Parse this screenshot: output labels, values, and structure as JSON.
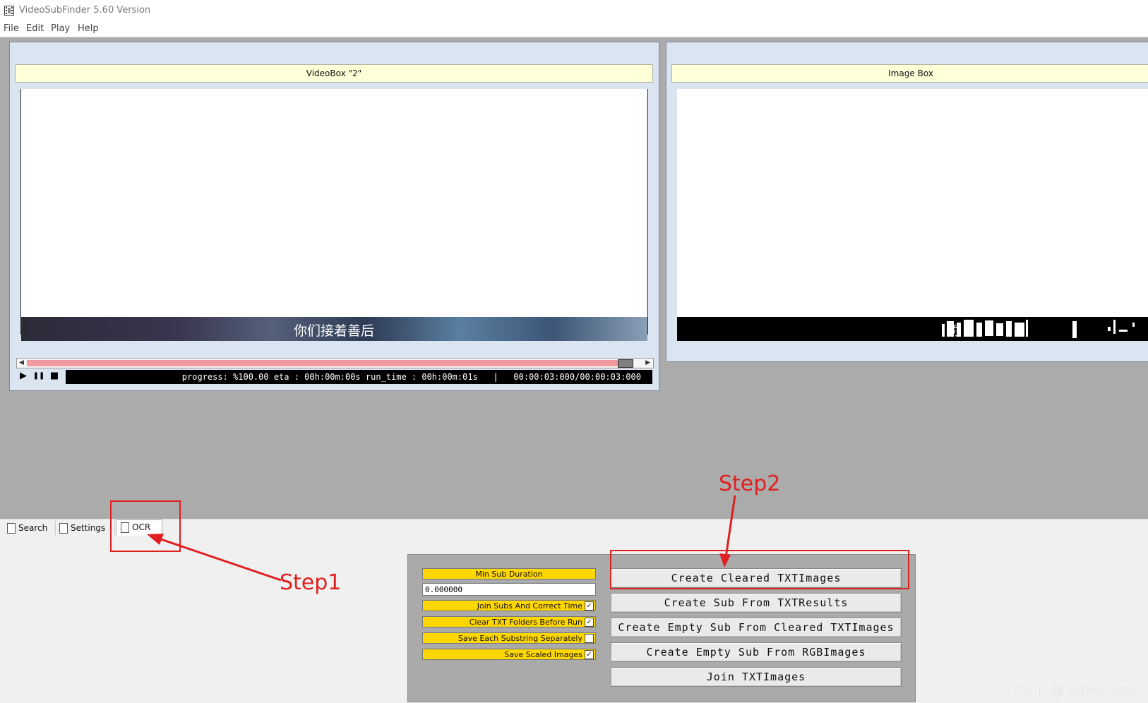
{
  "window": {
    "title": "VideoSubFinder 5.60 Version"
  },
  "menu": [
    "File",
    "Edit",
    "Play",
    "Help"
  ],
  "video_box": {
    "title": "VideoBox \"2\"",
    "subtitle_text": "你们接着善后",
    "status": "progress: %100.00 eta : 00h:00m:00s run_time : 00h:00m:01s   |   00:00:03:000/00:00:03:000"
  },
  "image_box": {
    "title": "Image Box",
    "subtitle_text": "你"
  },
  "tabs": [
    {
      "label": "Search"
    },
    {
      "label": "Settings"
    },
    {
      "label": "OCR"
    }
  ],
  "ocr": {
    "min_sub_duration_label": "Min Sub Duration",
    "min_sub_duration_value": "0.000000",
    "options": [
      {
        "label": "Join Subs And Correct Time",
        "checked": true
      },
      {
        "label": "Clear TXT Folders Before Run",
        "checked": true
      },
      {
        "label": "Save Each Substring Separately",
        "checked": false
      },
      {
        "label": "Save Scaled Images",
        "checked": true
      }
    ],
    "buttons": [
      "Create Cleared TXTImages",
      "Create Sub From TXTResults",
      "Create Empty Sub From Cleared TXTImages",
      "Create Empty Sub From RGBImages",
      "Join TXTImages"
    ]
  },
  "annotations": {
    "step1": "Step1",
    "step2": "Step2"
  },
  "watermark": "CSDN @Liekkas Kono",
  "colors": {
    "accent_yellow": "#ffd700",
    "annotation_red": "#e02020",
    "scroll_track": "#f09aa0"
  },
  "icons": {
    "play": "▶",
    "pause": "❚❚",
    "stop": "■",
    "check": "✓"
  }
}
